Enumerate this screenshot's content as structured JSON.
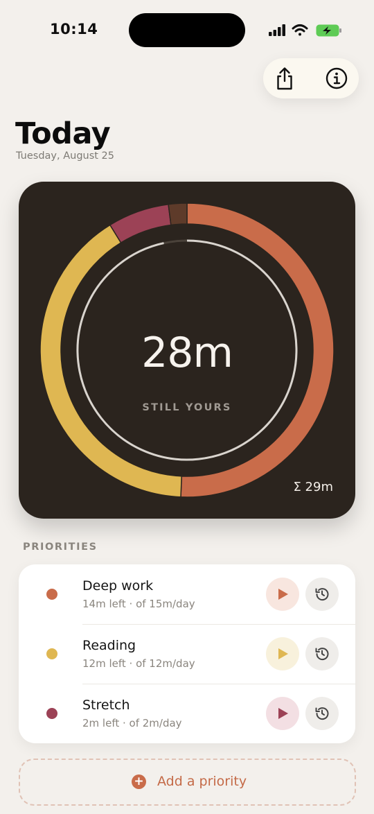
{
  "status_bar": {
    "time": "10:14"
  },
  "header": {
    "title": "Today",
    "date": "Tuesday, August 25"
  },
  "summary": {
    "remaining": "28m",
    "remaining_label": "STILL YOURS",
    "total": "Σ 29m"
  },
  "chart_data": {
    "type": "donut",
    "unit": "minutes",
    "segments": [
      {
        "label": "Deep work",
        "value": 15,
        "color": "#c96c4a"
      },
      {
        "label": "Reading",
        "value": 12,
        "color": "#dfb752"
      },
      {
        "label": "Stretch",
        "value": 2,
        "color": "#9c4256"
      },
      {
        "label": "",
        "value": 0.6,
        "color": "#5e3b2a"
      }
    ],
    "inner_progress": 0.966
  },
  "priorities": {
    "section_label": "PRIORITIES",
    "items": [
      {
        "name": "Deep work",
        "sub": "14m left · of 15m/day",
        "color": "#c96c4a",
        "play_bg": "#f8e6df",
        "play_color": "#c96c4a"
      },
      {
        "name": "Reading",
        "sub": "12m left · of 12m/day",
        "color": "#dfb752",
        "play_bg": "#f8f1dc",
        "play_color": "#dfb752"
      },
      {
        "name": "Stretch",
        "sub": "2m left · of 2m/day",
        "color": "#9c4256",
        "play_bg": "#f3dfe3",
        "play_color": "#9c4256"
      }
    ],
    "add_label": "Add a priority"
  },
  "icons": {
    "share": "share-icon",
    "info": "info-icon",
    "play": "play-icon",
    "history": "history-icon",
    "plus": "plus-icon"
  }
}
